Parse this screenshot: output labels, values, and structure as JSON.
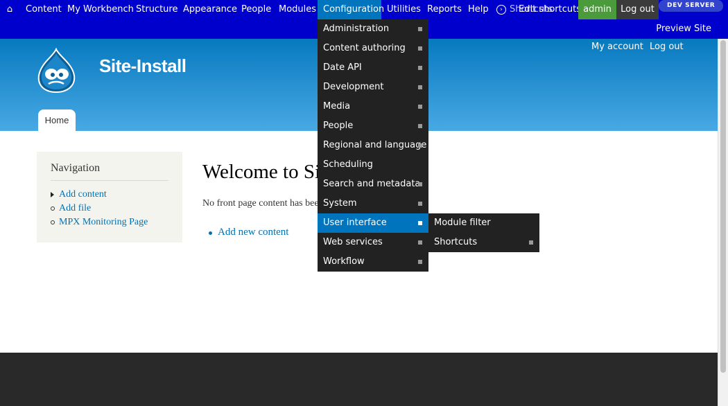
{
  "toolbar": {
    "home_icon": "home-icon",
    "items": [
      "Content",
      "My Workbench",
      "Structure",
      "Appearance",
      "People",
      "Modules",
      "Configuration",
      "Utilities",
      "Reports",
      "Help"
    ],
    "shortcuts_label": "Shortcuts",
    "edit_shortcuts_label": "Edit shortcuts",
    "user": "admin",
    "logout": "Log out",
    "dev_server": "DEV SERVER",
    "preview_site": "Preview Site"
  },
  "header": {
    "site_name": "Site-Install",
    "my_account": "My account",
    "logout": "Log out",
    "tab_home": "Home"
  },
  "sidebar": {
    "title": "Navigation",
    "items": [
      {
        "label": "Add content"
      },
      {
        "label": "Add file"
      },
      {
        "label": "MPX Monitoring Page"
      }
    ]
  },
  "main": {
    "title": "Welcome to Site-Install",
    "message": "No front page content has been created yet.",
    "add_new": "Add new content"
  },
  "config_menu": {
    "items": [
      {
        "label": "Administration"
      },
      {
        "label": "Content authoring"
      },
      {
        "label": "Date API"
      },
      {
        "label": "Development"
      },
      {
        "label": "Media"
      },
      {
        "label": "People"
      },
      {
        "label": "Regional and language"
      },
      {
        "label": "Scheduling"
      },
      {
        "label": "Search and metadata"
      },
      {
        "label": "System"
      },
      {
        "label": "User interface"
      },
      {
        "label": "Web services"
      },
      {
        "label": "Workflow"
      }
    ]
  },
  "sub_menu": {
    "items": [
      {
        "label": "Module filter"
      },
      {
        "label": "Shortcuts"
      }
    ]
  },
  "colors": {
    "toolbar": "#0000cc",
    "active": "#0074bd",
    "menu": "#222222",
    "admin": "#4b9a3b"
  }
}
